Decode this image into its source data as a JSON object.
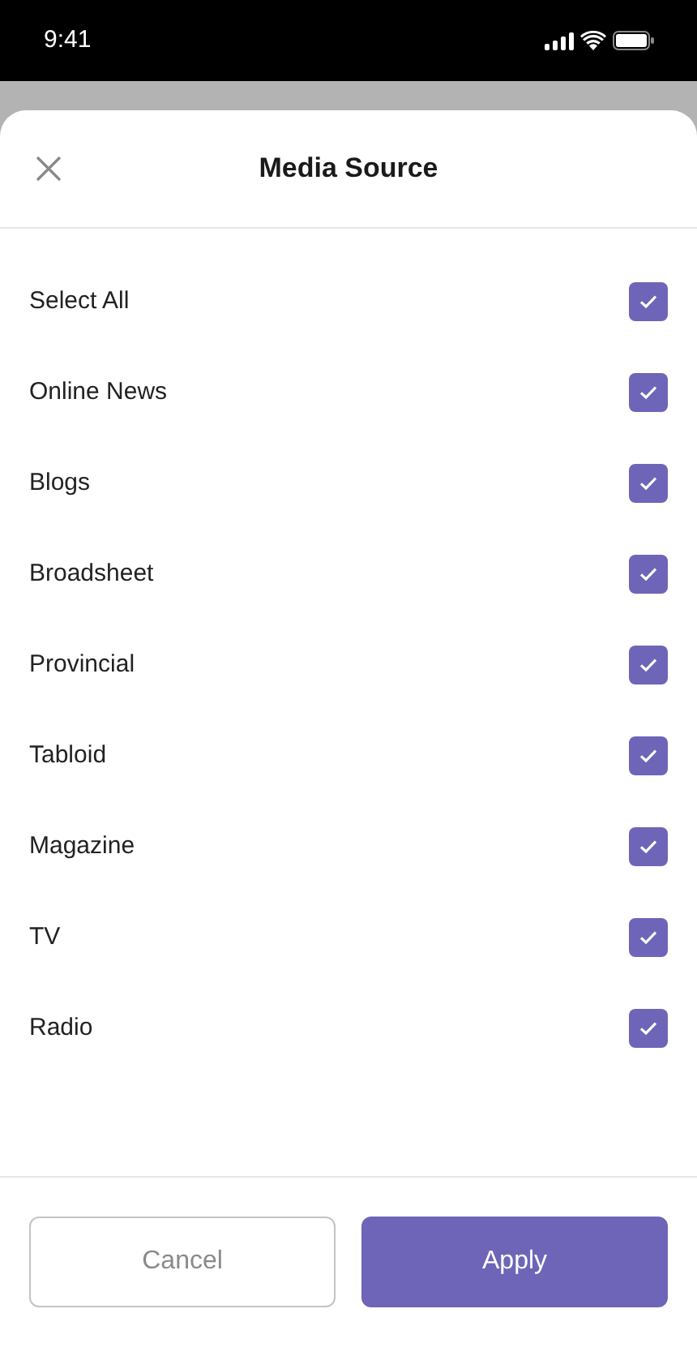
{
  "status_bar": {
    "time": "9:41"
  },
  "sheet": {
    "title": "Media Source"
  },
  "options": [
    {
      "label": "Select All",
      "checked": true
    },
    {
      "label": "Online News",
      "checked": true
    },
    {
      "label": "Blogs",
      "checked": true
    },
    {
      "label": "Broadsheet",
      "checked": true
    },
    {
      "label": "Provincial",
      "checked": true
    },
    {
      "label": "Tabloid",
      "checked": true
    },
    {
      "label": "Magazine",
      "checked": true
    },
    {
      "label": "TV",
      "checked": true
    },
    {
      "label": "Radio",
      "checked": true
    }
  ],
  "buttons": {
    "cancel": "Cancel",
    "apply": "Apply"
  }
}
